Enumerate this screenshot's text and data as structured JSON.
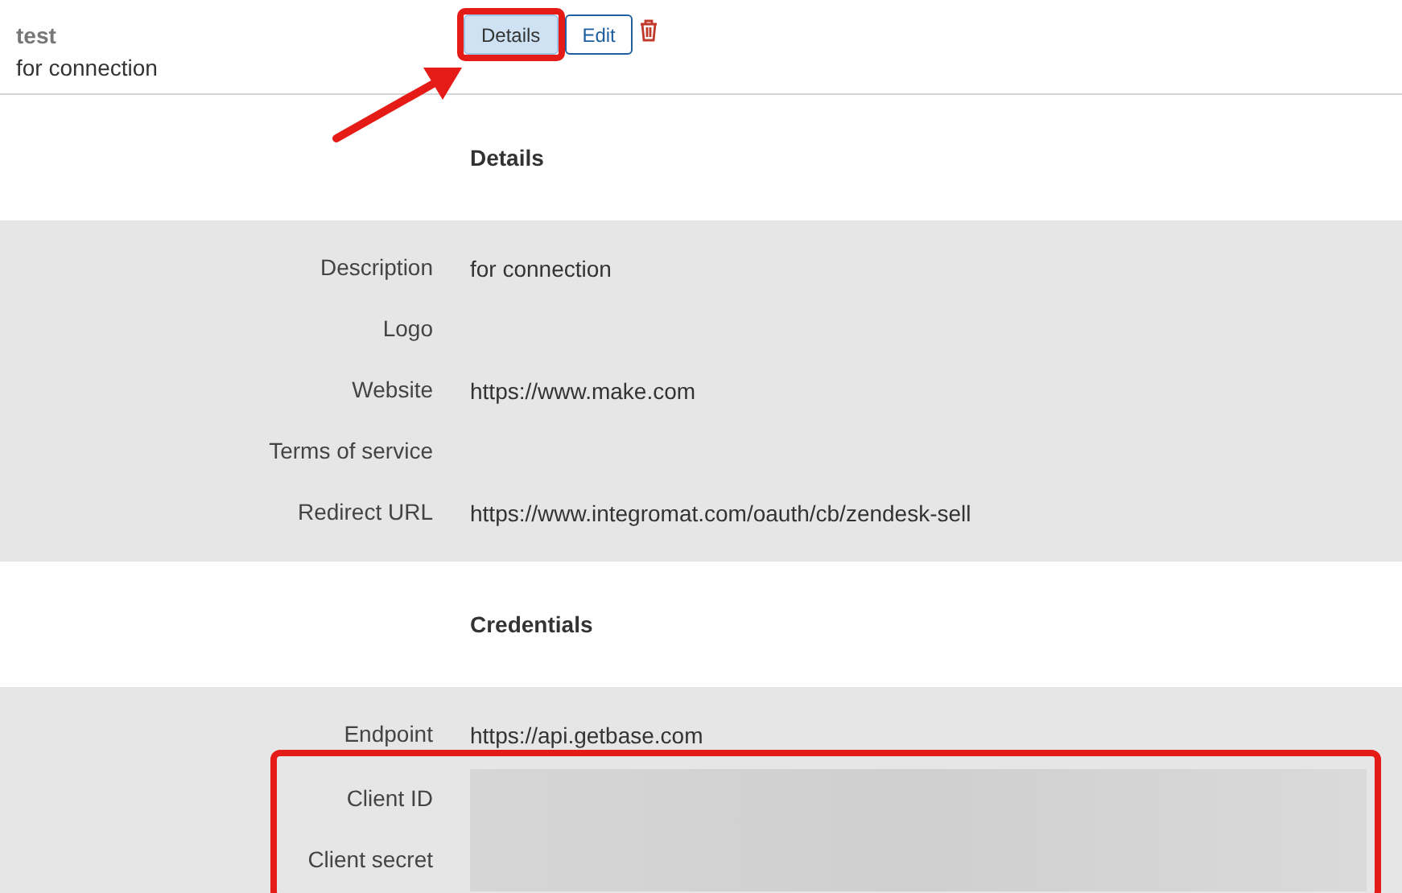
{
  "header": {
    "title": "test",
    "subtitle": "for connection",
    "buttons": [
      {
        "label": "Details",
        "selected": true
      },
      {
        "label": "Edit",
        "selected": false
      }
    ]
  },
  "sections": [
    {
      "heading": "Details",
      "rows": [
        {
          "label": "Description",
          "kind": "text",
          "value": "for connection"
        },
        {
          "label": "Logo",
          "kind": "empty"
        },
        {
          "label": "Website",
          "kind": "text",
          "value": "https://www.make.com"
        },
        {
          "label": "Terms of service",
          "kind": "empty"
        },
        {
          "label": "Redirect URL",
          "kind": "text",
          "value": "https://www.integromat.com/oauth/cb/zendesk-sell"
        }
      ]
    },
    {
      "heading": "Credentials",
      "rows": [
        {
          "label": "Endpoint",
          "kind": "text",
          "value": "https://api.getbase.com"
        },
        {
          "label": "Client ID",
          "kind": "redacted"
        },
        {
          "label": "Client secret",
          "kind": "redacted"
        }
      ]
    }
  ]
}
